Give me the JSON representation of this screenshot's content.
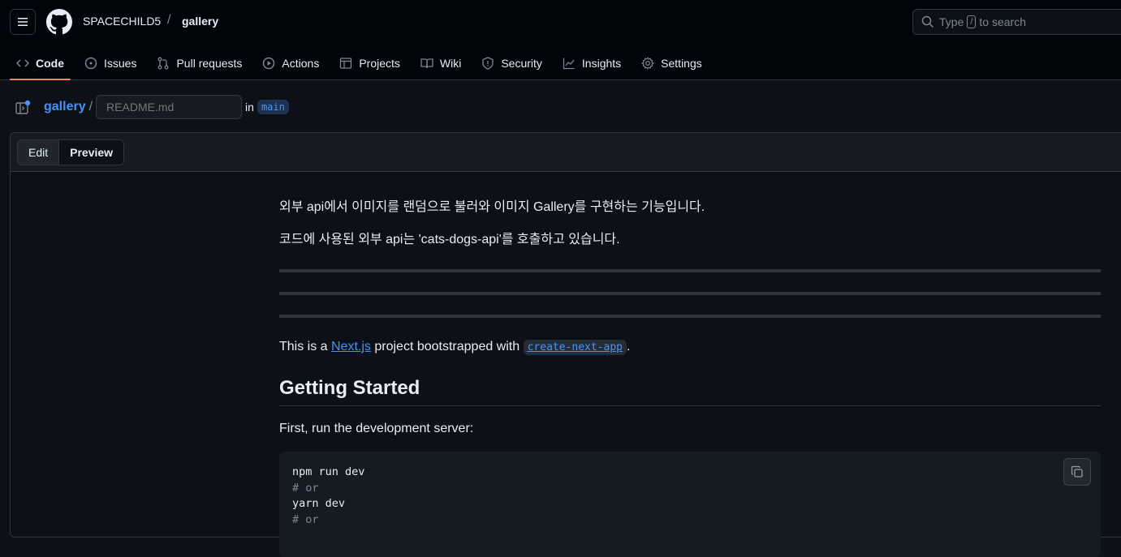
{
  "header": {
    "owner": "SPACECHILD5",
    "separator": "/",
    "repo": "gallery",
    "search": {
      "prefix": "Type",
      "key": "/",
      "suffix": "to search"
    }
  },
  "nav": {
    "items": [
      {
        "label": "Code",
        "icon": "code-icon",
        "active": true
      },
      {
        "label": "Issues",
        "icon": "issue-icon"
      },
      {
        "label": "Pull requests",
        "icon": "pull-request-icon"
      },
      {
        "label": "Actions",
        "icon": "play-icon"
      },
      {
        "label": "Projects",
        "icon": "table-icon"
      },
      {
        "label": "Wiki",
        "icon": "book-icon"
      },
      {
        "label": "Security",
        "icon": "shield-icon"
      },
      {
        "label": "Insights",
        "icon": "graph-icon"
      },
      {
        "label": "Settings",
        "icon": "gear-icon"
      }
    ]
  },
  "path": {
    "repo": "gallery",
    "separator": "/",
    "filename_placeholder": "README.md",
    "in_label": "in",
    "branch": "main"
  },
  "editor": {
    "tabs": {
      "edit": "Edit",
      "preview": "Preview"
    }
  },
  "preview": {
    "p1": "외부 api에서 이미지를 랜덤으로 불러와 이미지 Gallery를 구현하는 기능입니다.",
    "p2": "코드에 사용된 외부 api는 'cats-dogs-api'를 호출하고 있습니다.",
    "p3_before": "This is a ",
    "p3_link": "Next.js",
    "p3_middle": " project bootstrapped with ",
    "p3_code": "create-next-app",
    "p3_after": ".",
    "heading": "Getting Started",
    "p4": "First, run the development server:",
    "code_lines": [
      "npm run dev",
      "# or",
      "yarn dev",
      "# or"
    ]
  },
  "colors": {
    "accent": "#4493f8",
    "active_underline": "#f78166",
    "background": "#0d1117"
  }
}
